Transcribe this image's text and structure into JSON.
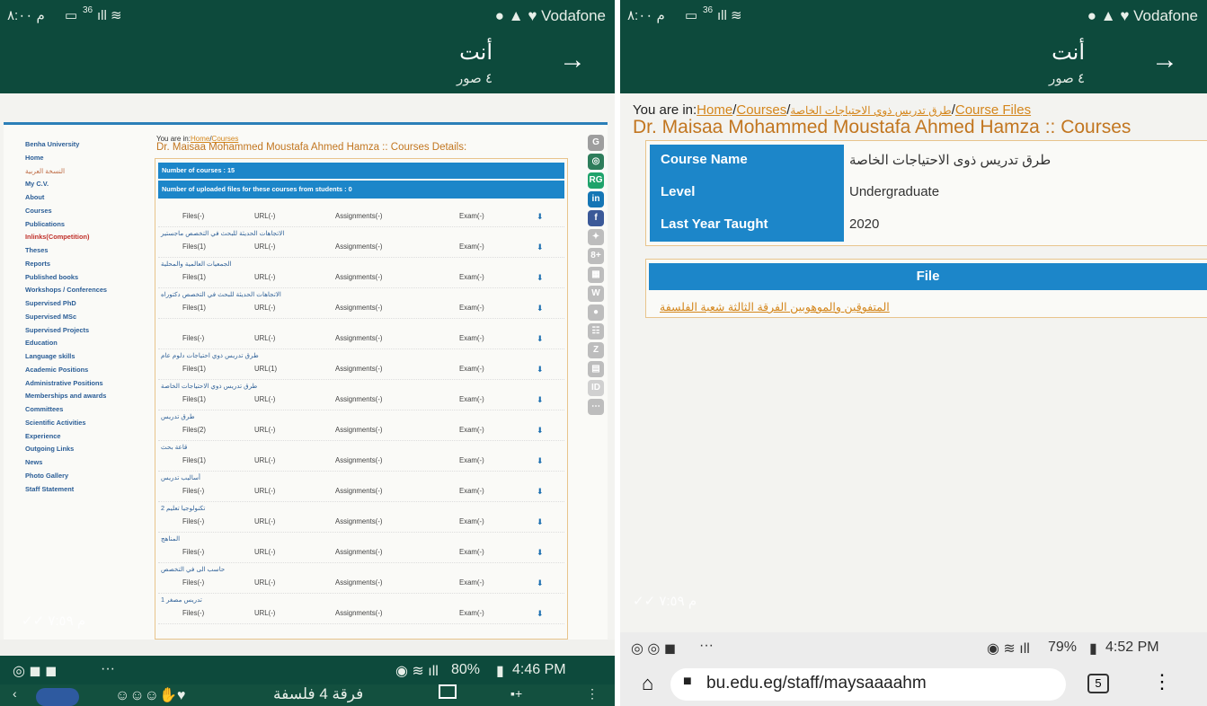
{
  "left": {
    "status_left": "م ٨:٠٠",
    "status_signal": "36",
    "status_right": "Vodafone",
    "title_name": "أنت",
    "title_sub": "٤ صور",
    "site": {
      "breadcrumb_prefix": "You are in:",
      "breadcrumb_home": "Home",
      "breadcrumb_courses": "Courses",
      "page_title": "Dr. Maisaa Mohammed Moustafa Ahmed Hamza :: Courses Details:",
      "sidebar": [
        "Benha University",
        "Home",
        "النسخة العربية",
        "My C.V.",
        "About",
        "Courses",
        "Publications",
        "Inlinks(Competition)",
        "Theses",
        "Reports",
        "Published books",
        "Workshops / Conferences",
        "Supervised PhD",
        "Supervised MSc",
        "Supervised Projects",
        "Education",
        "Language skills",
        "Academic Positions",
        "Administrative Positions",
        "Memberships and awards",
        "Committees",
        "Scientific Activities",
        "Experience",
        "Outgoing Links",
        "News",
        "Photo Gallery",
        "Staff Statement"
      ],
      "num_courses": "Number of courses : 15",
      "num_files": "Number of uploaded files for these courses from students : 0",
      "courses": [
        {
          "title": "",
          "files": "Files(-)",
          "url": "URL(-)",
          "assign": "Assignments(-)",
          "exam": "Exam(-)"
        },
        {
          "title": "الاتجاهات الحديثة للبحث في التخصص ماجستير",
          "files": "Files(1)",
          "url": "URL(-)",
          "assign": "Assignments(-)",
          "exam": "Exam(-)"
        },
        {
          "title": "الجمعيات العالمية والمحلية",
          "files": "Files(1)",
          "url": "URL(-)",
          "assign": "Assignments(-)",
          "exam": "Exam(-)"
        },
        {
          "title": "الاتجاهات الحديثة للبحث في التخصص دكتوراه",
          "files": "Files(1)",
          "url": "URL(-)",
          "assign": "Assignments(-)",
          "exam": "Exam(-)"
        },
        {
          "title": "",
          "files": "Files(-)",
          "url": "URL(-)",
          "assign": "Assignments(-)",
          "exam": "Exam(-)"
        },
        {
          "title": "طرق تدريس ذوي احتياجات دلوم عام",
          "files": "Files(1)",
          "url": "URL(1)",
          "assign": "Assignments(-)",
          "exam": "Exam(-)"
        },
        {
          "title": "طرق تدريس ذوي الاحتياجات الخاصة",
          "files": "Files(1)",
          "url": "URL(-)",
          "assign": "Assignments(-)",
          "exam": "Exam(-)"
        },
        {
          "title": "طرق تدريس",
          "files": "Files(2)",
          "url": "URL(-)",
          "assign": "Assignments(-)",
          "exam": "Exam(-)"
        },
        {
          "title": "قاعة بحث",
          "files": "Files(1)",
          "url": "URL(-)",
          "assign": "Assignments(-)",
          "exam": "Exam(-)"
        },
        {
          "title": "أساليب تدريس",
          "files": "Files(-)",
          "url": "URL(-)",
          "assign": "Assignments(-)",
          "exam": "Exam(-)"
        },
        {
          "title": "تكنولوجيا تعليم 2",
          "files": "Files(-)",
          "url": "URL(-)",
          "assign": "Assignments(-)",
          "exam": "Exam(-)"
        },
        {
          "title": "المناهج",
          "files": "Files(-)",
          "url": "URL(-)",
          "assign": "Assignments(-)",
          "exam": "Exam(-)"
        },
        {
          "title": "حاسب الى في التخصص",
          "files": "Files(-)",
          "url": "URL(-)",
          "assign": "Assignments(-)",
          "exam": "Exam(-)"
        },
        {
          "title": "تدريس مصغر 1",
          "files": "Files(-)",
          "url": "URL(-)",
          "assign": "Assignments(-)",
          "exam": "Exam(-)"
        }
      ],
      "social": [
        {
          "label": "G",
          "color": "#9e9e9e"
        },
        {
          "label": "◎",
          "color": "#2e7d5b"
        },
        {
          "label": "RG",
          "color": "#1fa36b"
        },
        {
          "label": "in",
          "color": "#1576b5"
        },
        {
          "label": "f",
          "color": "#3b5998"
        },
        {
          "label": "✦",
          "color": "#bdbdbd"
        },
        {
          "label": "8+",
          "color": "#bdbdbd"
        },
        {
          "label": "▦",
          "color": "#bdbdbd"
        },
        {
          "label": "W",
          "color": "#bdbdbd"
        },
        {
          "label": "●",
          "color": "#bdbdbd"
        },
        {
          "label": "☷",
          "color": "#bdbdbd"
        },
        {
          "label": "Z",
          "color": "#bdbdbd"
        },
        {
          "label": "▤",
          "color": "#bdbdbd"
        },
        {
          "label": "ID",
          "color": "#d0d0d0"
        },
        {
          "label": "⋯",
          "color": "#bdbdbd"
        }
      ]
    },
    "time_stamp": "م ٧:٥٩",
    "bottom_status": "80%",
    "bottom_time": "4:46 PM",
    "bottom_dots": "···",
    "chat_text": "فرقة 4 فلسفة"
  },
  "right": {
    "status_left": "م ٨:٠٠",
    "status_signal": "36",
    "status_right": "Vodafone",
    "title_name": "أنت",
    "title_sub": "٤ صور",
    "breadcrumb_prefix": "You are in:",
    "breadcrumb_home": "Home",
    "breadcrumb_courses": "Courses",
    "breadcrumb_course": "طرق تدريس ذوي الاحتياجات الخاصة",
    "breadcrumb_files": "Course Files",
    "page_title": "Dr. Maisaa Mohammed Moustafa Ahmed Hamza :: Courses",
    "course_name_label": "Course Name",
    "course_name_value": "طرق تدريس ذوى الاحتياجات الخاصة",
    "level_label": "Level",
    "level_value": "Undergraduate",
    "last_year_label": "Last Year Taught",
    "last_year_value": "2020",
    "file_header": "File",
    "file_link": "المتفوقين والموهوبين الفرقة الثالثة شعبة الفلسفة",
    "time_stamp": "م ٧:٥٩",
    "bottom_dots": "···",
    "battery": "79%",
    "bottom_time": "4:52 PM",
    "url": "bu.edu.eg/staff/maysaaaahm",
    "tabs_count": "5"
  }
}
